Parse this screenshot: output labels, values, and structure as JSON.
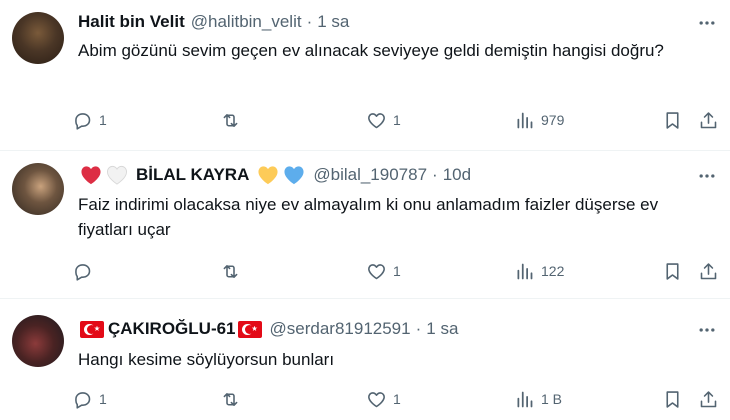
{
  "tweets": [
    {
      "name": "Halit bin Velit",
      "handle": "@halitbin_velit",
      "dot": "·",
      "time": "1 sa",
      "text": "Abim gözünü sevim geçen ev alınacak seviyeye geldi demiştin hangisi doğru?",
      "replies": "1",
      "retweets": "",
      "likes": "1",
      "views": "979",
      "avatar_icon": "avatar-photo"
    },
    {
      "name_prefix_icons": [
        "red-heart-icon",
        "white-heart-icon"
      ],
      "name": "BİLAL KAYRA",
      "name_suffix_icons": [
        "yellow-heart-icon",
        "blue-heart-icon"
      ],
      "handle": "@bilal_190787",
      "dot": "·",
      "time": "10d",
      "text": "Faiz indirimi olacaksa niye ev almayalım ki onu anlamadım faizler düşerse ev fiyatları uçar",
      "replies": "",
      "retweets": "",
      "likes": "1",
      "views": "122",
      "avatar_icon": "avatar-photo"
    },
    {
      "name": "ÇAKIROĞLU-61",
      "name_flags": [
        "turkey-flag-icon",
        "turkey-flag-icon"
      ],
      "handle": "@serdar81912591",
      "dot": "·",
      "time": "1 sa",
      "text": "Hangı kesime söylüyorsun bunları",
      "replies": "1",
      "retweets": "",
      "likes": "1",
      "views": "1 B",
      "avatar_icon": "avatar-photo"
    }
  ],
  "colors": {
    "text": "#0f1419",
    "secondary": "#536471",
    "divider": "#eff3f4",
    "red_heart": "#dd2e44",
    "yellow_heart": "#fdcb58",
    "blue_heart": "#5dadec",
    "turkey_red": "#e30a17"
  }
}
